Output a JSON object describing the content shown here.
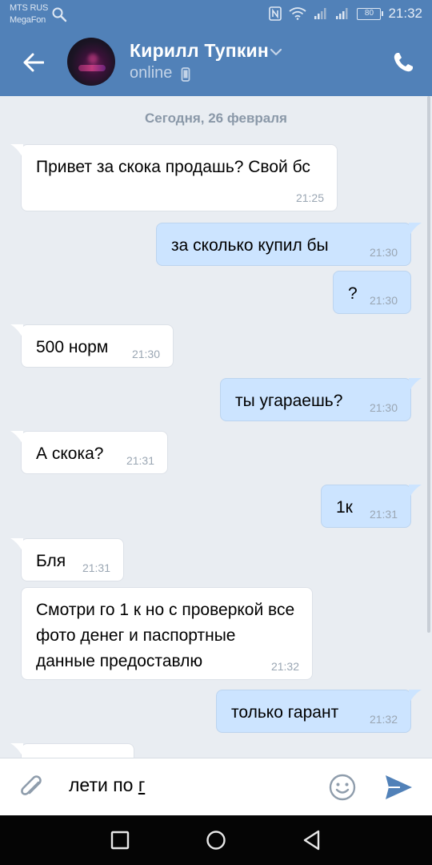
{
  "status_bar": {
    "carrier1": "MTS RUS",
    "carrier2": "MegaFon",
    "battery": "80",
    "time": "21:32"
  },
  "header": {
    "name": "Кирилл Тупкин",
    "status": "online"
  },
  "date_separator": "Сегодня, 26 февраля",
  "messages": [
    {
      "dir": "in",
      "text": "Привет за скока продашь? Свой бс",
      "time": "21:25"
    },
    {
      "dir": "out",
      "text": "за сколько купил бы",
      "time": "21:30"
    },
    {
      "dir": "out",
      "text": "?",
      "time": "21:30"
    },
    {
      "dir": "in",
      "text": "500 норм",
      "time": "21:30"
    },
    {
      "dir": "out",
      "text": "ты угараешь?",
      "time": "21:30"
    },
    {
      "dir": "in",
      "text": "А скока?",
      "time": "21:31"
    },
    {
      "dir": "out",
      "text": "1к",
      "time": "21:31"
    },
    {
      "dir": "in",
      "text": "Бля",
      "time": "21:31"
    },
    {
      "dir": "in",
      "text": "Смотри го 1 к но с проверкой все фото денег и паспортные данные предоставлю",
      "time": "21:32"
    },
    {
      "dir": "out",
      "text": "только гарант",
      "time": "21:32"
    },
    {
      "dir": "in",
      "text": "",
      "time": ""
    }
  ],
  "composer": {
    "value_prefix": "лети по ",
    "value_underlined": "г"
  },
  "colors": {
    "header": "#5181b8",
    "incoming_bubble": "#ffffff",
    "outgoing_bubble": "#cce4ff",
    "background": "#e9edf2",
    "send": "#5181b8"
  }
}
